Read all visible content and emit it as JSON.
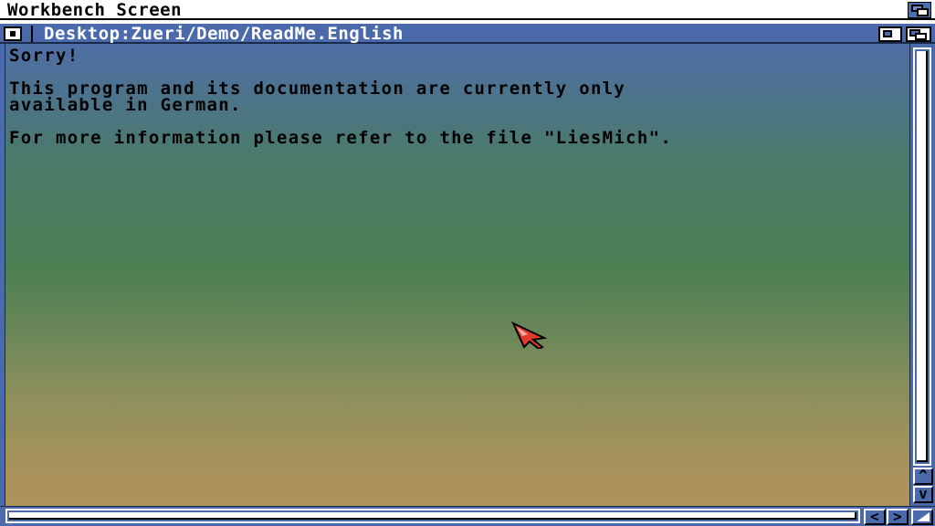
{
  "screen": {
    "title": "Workbench Screen"
  },
  "window": {
    "title": "Desktop:Zueri/Demo/ReadMe.English",
    "lines": [
      "Sorry!",
      "",
      "This program and its documentation are currently only",
      "available in German.",
      "",
      "For more information please refer to the file \"LiesMich\"."
    ]
  },
  "scroll": {
    "up_arrow": "^",
    "down_arrow": "v",
    "left_arrow": "<",
    "right_arrow": ">"
  },
  "icons": {
    "close": "close-icon",
    "zoom": "zoom-icon",
    "depth": "depth-icon",
    "resize": "resize-icon",
    "pointer": "mouse-pointer-icon"
  },
  "colors": {
    "chrome_blue": "#4a6aac",
    "pointer_red": "#e23a2a"
  }
}
